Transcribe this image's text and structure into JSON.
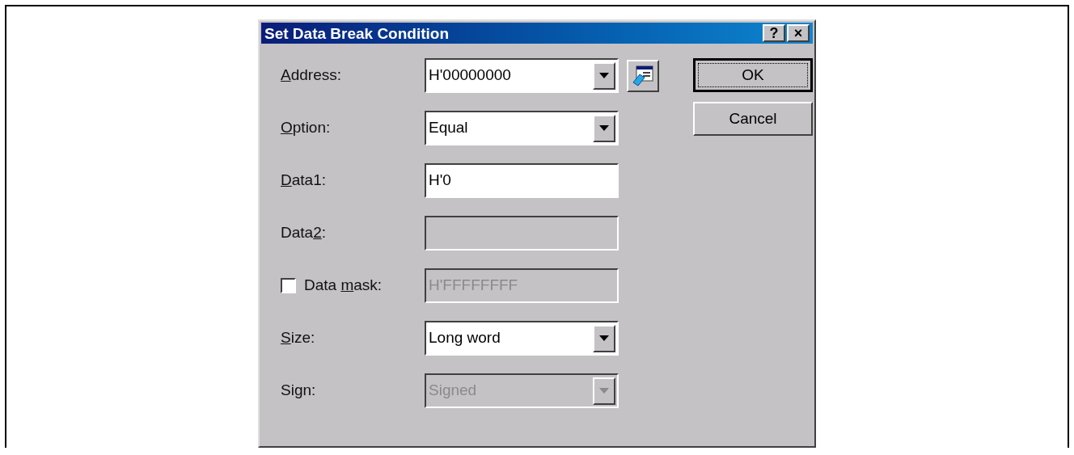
{
  "window": {
    "title": "Set Data Break Condition",
    "title_buttons": [
      "?",
      "×"
    ]
  },
  "fields": [
    {
      "label": {
        "key": "A",
        "after": "ddress:"
      },
      "kind": "combo",
      "value": "H'00000000",
      "disabled": false,
      "browse_button": true
    },
    {
      "label": {
        "key": "O",
        "after": "ption:"
      },
      "kind": "combo",
      "value": "Equal",
      "disabled": false
    },
    {
      "label": {
        "key": "D",
        "after": "ata1:"
      },
      "kind": "text",
      "value": "H'0",
      "disabled": false
    },
    {
      "label": {
        "before": "Data",
        "key": "2",
        "after": ":"
      },
      "kind": "text",
      "disabled": true
    },
    {
      "label": {
        "before": "Data ",
        "key": "m",
        "after": "ask:"
      },
      "kind": "text",
      "value": "H'FFFFFFFF",
      "disabled": true,
      "checkbox": {
        "checked": false
      }
    },
    {
      "label": {
        "key": "S",
        "after": "ize:"
      },
      "kind": "combo",
      "value": "Long word",
      "disabled": false
    },
    {
      "label": {
        "before": "Sign:"
      },
      "kind": "combo",
      "value": "Signed",
      "disabled": true
    }
  ],
  "buttons": [
    {
      "label": "OK",
      "default": true
    },
    {
      "label": "Cancel",
      "default": false
    }
  ]
}
